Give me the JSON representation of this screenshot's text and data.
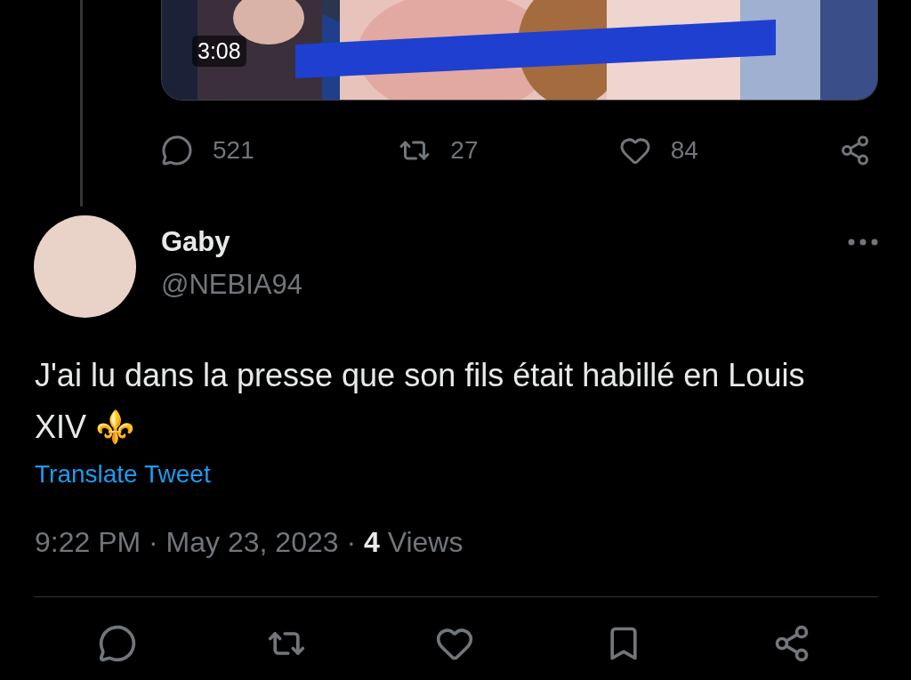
{
  "quoted_post": {
    "media": {
      "kind": "picture",
      "duration": "3:08"
    },
    "actions": [
      {
        "kind": "reply",
        "count": "521"
      },
      {
        "kind": "repost",
        "count": "27"
      },
      {
        "kind": "like",
        "count": "84"
      },
      {
        "kind": "share"
      }
    ]
  },
  "post": {
    "author": {
      "name": "Gaby",
      "handle": "@NEBIA94"
    },
    "text": "J'ai lu dans la presse que son fils était habillé en Louis XIV ⚜️",
    "translate_link": "Translate Tweet",
    "meta": "9:22 PM · May 23, 2023 · **4** Views",
    "actions": [
      {
        "kind": "reply"
      },
      {
        "kind": "repost"
      },
      {
        "kind": "like"
      },
      {
        "kind": "bookmark"
      },
      {
        "kind": "share"
      }
    ]
  }
}
